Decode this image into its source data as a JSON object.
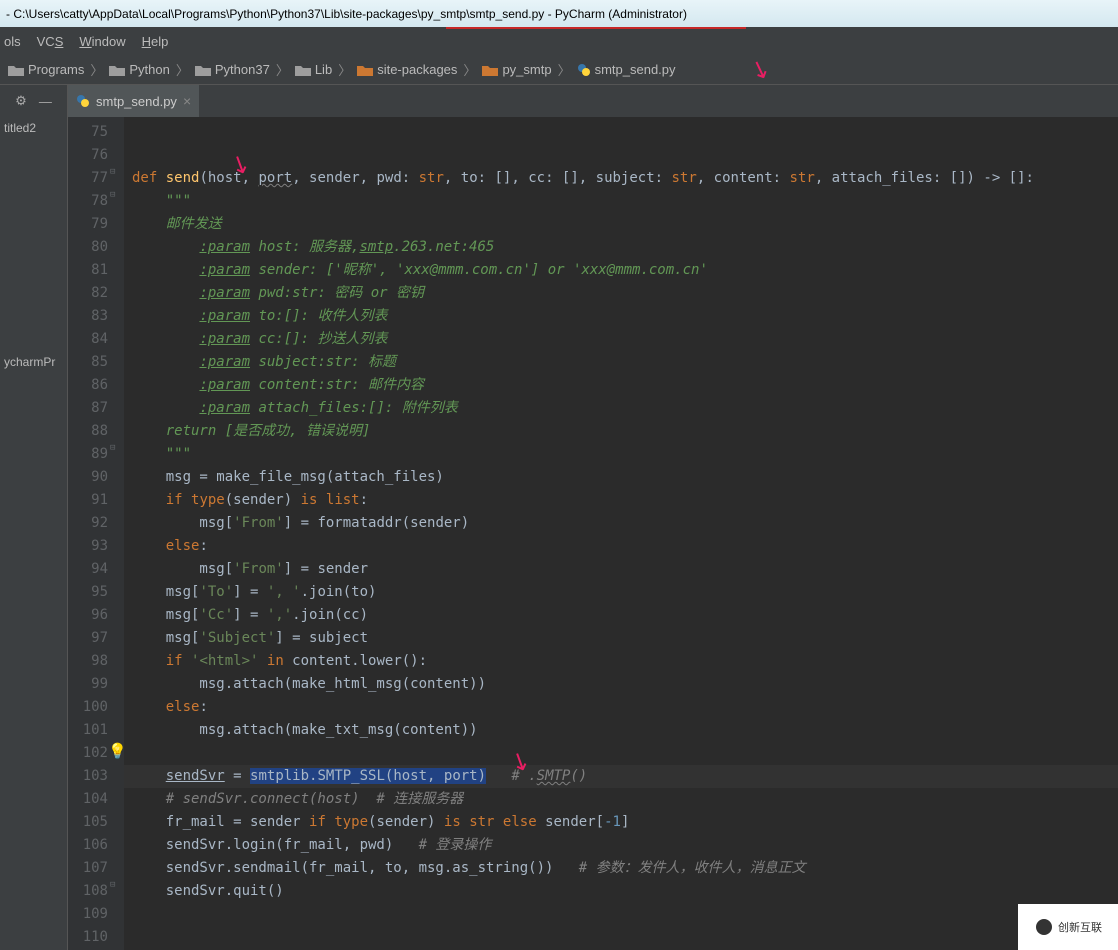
{
  "title": {
    "path": " - C:\\Users\\catty\\AppData\\Local\\Programs\\Python\\Python37\\Lib\\site-packages\\py_smtp\\smtp_send.py - PyCharm (Administrator)"
  },
  "menu": {
    "tools": "ols",
    "vcs": "VCS",
    "window": "Window",
    "help": "Help"
  },
  "breadcrumbs": [
    {
      "label": "Programs",
      "color": "#b0b0b0"
    },
    {
      "label": "Python",
      "color": "#b0b0b0"
    },
    {
      "label": "Python37",
      "color": "#b0b0b0"
    },
    {
      "label": "Lib",
      "color": "#b0b0b0"
    },
    {
      "label": "site-packages",
      "color": "#cc7832"
    },
    {
      "label": "py_smtp",
      "color": "#cc7832"
    },
    {
      "label": "smtp_send.py",
      "color": "#b0b0b0",
      "isPy": true
    }
  ],
  "tab": {
    "name": "smtp_send.py"
  },
  "side": {
    "item1": "titled2",
    "item2": "ycharmPr"
  },
  "code_first_line": 75,
  "lines": [
    "",
    "",
    {
      "def": "def",
      "fn": "send",
      "sig_a": "(host, ",
      "port": "port",
      "sig_b": ", sender, pwd: ",
      "str1": "str",
      "sig_c": ", to: [], cc: [], subject: ",
      "str2": "str",
      "sig_d": ", content: ",
      "str3": "str",
      "sig_e": ", attach_files: []) -> []:"
    },
    {
      "type": "doc",
      "text": "\"\"\""
    },
    {
      "type": "doc",
      "text": "邮件发送"
    },
    {
      "type": "param",
      "label": ":param",
      "rest": " host: 服务器,",
      "link": "smtp",
      "tail": ".263.net:465"
    },
    {
      "type": "param",
      "label": ":param",
      "rest": " sender: ['昵称', 'xxx@mmm.com.cn'] or 'xxx@mmm.com.cn'"
    },
    {
      "type": "param",
      "label": ":param",
      "rest": " pwd:str: 密码 or 密钥"
    },
    {
      "type": "param",
      "label": ":param",
      "rest": " to:[]: 收件人列表"
    },
    {
      "type": "param",
      "label": ":param",
      "rest": " cc:[]: 抄送人列表"
    },
    {
      "type": "param",
      "label": ":param",
      "rest": " subject:str: 标题"
    },
    {
      "type": "param",
      "label": ":param",
      "rest": " content:str: 邮件内容"
    },
    {
      "type": "param",
      "label": ":param",
      "rest": " attach_files:[]: 附件列表"
    },
    {
      "type": "ret",
      "label": "return",
      "rest": " [是否成功, 错误说明]"
    },
    {
      "type": "doc",
      "text": "\"\"\""
    },
    {
      "type": "code",
      "text": "msg = make_file_msg(attach_files)"
    },
    {
      "type": "code_kw",
      "kw": "if",
      "text": " ",
      "fn": "type",
      "text2": "(sender) ",
      "kw2": "is",
      "text3": " ",
      "kw3": "list",
      "text4": ":"
    },
    {
      "type": "code_str",
      "pre": "    msg[",
      "str": "'From'",
      "post": "] = formataddr(sender)"
    },
    {
      "type": "code_kw2",
      "kw": "else",
      "text": ":"
    },
    {
      "type": "code_str",
      "pre": "    msg[",
      "str": "'From'",
      "post": "] = sender"
    },
    {
      "type": "code_str",
      "pre": "msg[",
      "str": "'To'",
      "post": "] = ",
      "str2": "', '",
      "post2": ".join(to)"
    },
    {
      "type": "code_str",
      "pre": "msg[",
      "str": "'Cc'",
      "post": "] = ",
      "str2": "','",
      "post2": ".join(cc)"
    },
    {
      "type": "code_str",
      "pre": "msg[",
      "str": "'Subject'",
      "post": "] = subject"
    },
    {
      "type": "code_if_in",
      "kw": "if",
      "str": "'<html>'",
      "kw2": "in",
      "rest": " content.lower():"
    },
    {
      "type": "code",
      "text": "    msg.attach(make_html_msg(content))"
    },
    {
      "type": "code_kw2",
      "kw": "else",
      "text": ":"
    },
    {
      "type": "code",
      "text": "    msg.attach(make_txt_msg(content))"
    },
    {
      "type": "blank"
    },
    {
      "type": "code_sel",
      "pre": "",
      "var": "sendSvr",
      "eq": " = ",
      "sel": "smtplib.SMTP_SSL(host, port)",
      "post": "   ",
      "cm": "# .",
      "wavy": "SMTP",
      "cm2": "()"
    },
    {
      "type": "code_cm",
      "cm": "# sendSvr.connect(host)  # 连接服务器"
    },
    {
      "type": "code_fr",
      "a": "fr_mail = sender ",
      "kw": "if",
      "b": " ",
      "fn": "type",
      "c": "(sender) ",
      "kw2": "is",
      "d": " ",
      "kw3": "str",
      "e": " ",
      "kw4": "else",
      "f": " sender[",
      "num": "-1",
      "g": "]"
    },
    {
      "type": "code_login",
      "text": "sendSvr.login(fr_mail, pwd)   ",
      "cm": "# 登录操作"
    },
    {
      "type": "code_login",
      "text": "sendSvr.sendmail(fr_mail, to, msg.as_string())   ",
      "cm": "# 参数：发件人，收件人，消息正文"
    },
    {
      "type": "code",
      "text": "sendSvr.quit()"
    },
    {
      "type": "blank"
    },
    {
      "type": "blank"
    }
  ],
  "watermark": "创新互联"
}
